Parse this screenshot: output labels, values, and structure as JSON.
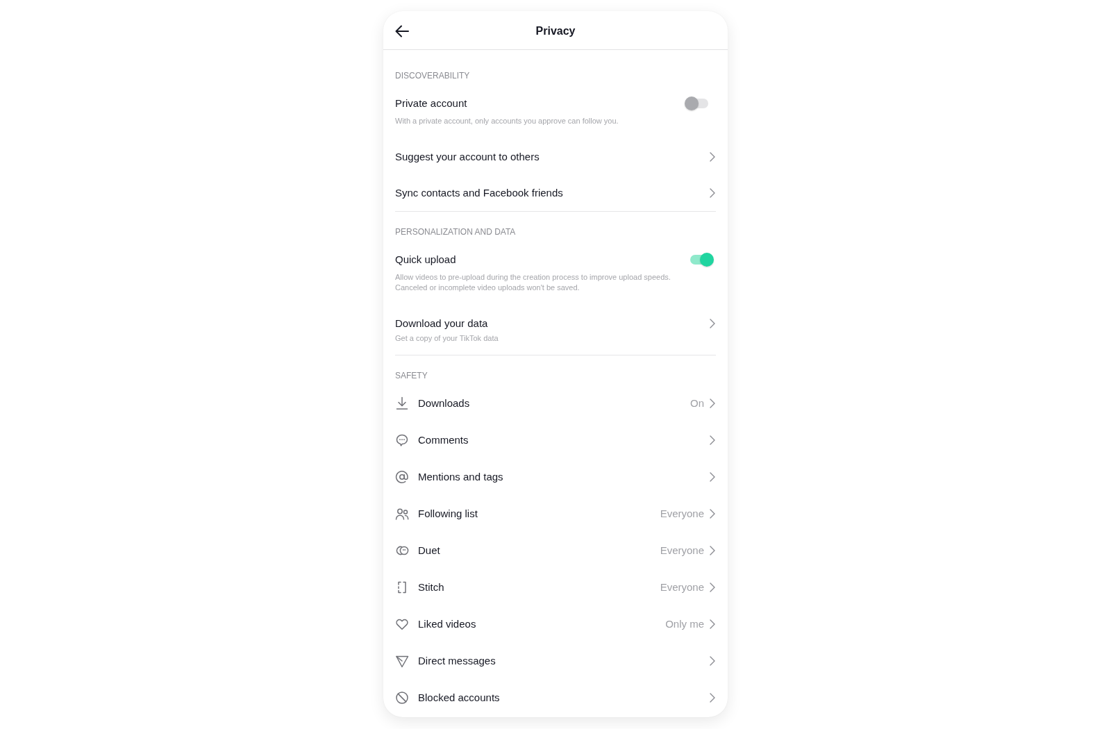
{
  "header": {
    "title": "Privacy"
  },
  "sections": [
    {
      "title": "DISCOVERABILITY",
      "items": [
        {
          "kind": "toggle",
          "label": "Private account",
          "description": "With a private account, only accounts you approve can follow you.",
          "on": false
        },
        {
          "kind": "link",
          "label": "Suggest your account to others"
        },
        {
          "kind": "link",
          "label": "Sync contacts and Facebook friends"
        }
      ]
    },
    {
      "title": "PERSONALIZATION AND DATA",
      "items": [
        {
          "kind": "toggle",
          "label": "Quick upload",
          "description": "Allow videos to pre-upload during the creation process to improve upload speeds. Canceled or incomplete video uploads won't be saved.",
          "on": true
        },
        {
          "kind": "link",
          "label": "Download your data",
          "description": "Get a copy of your TikTok data"
        }
      ]
    },
    {
      "title": "SAFETY",
      "items": [
        {
          "kind": "setting",
          "label": "Downloads",
          "value": "On"
        },
        {
          "kind": "setting",
          "label": "Comments"
        },
        {
          "kind": "setting",
          "label": "Mentions and tags"
        },
        {
          "kind": "setting",
          "label": "Following list",
          "value": "Everyone"
        },
        {
          "kind": "setting",
          "label": "Duet",
          "value": "Everyone"
        },
        {
          "kind": "setting",
          "label": "Stitch",
          "value": "Everyone"
        },
        {
          "kind": "setting",
          "label": "Liked videos",
          "value": "Only me"
        },
        {
          "kind": "setting",
          "label": "Direct messages"
        },
        {
          "kind": "setting",
          "label": "Blocked accounts"
        }
      ]
    }
  ]
}
